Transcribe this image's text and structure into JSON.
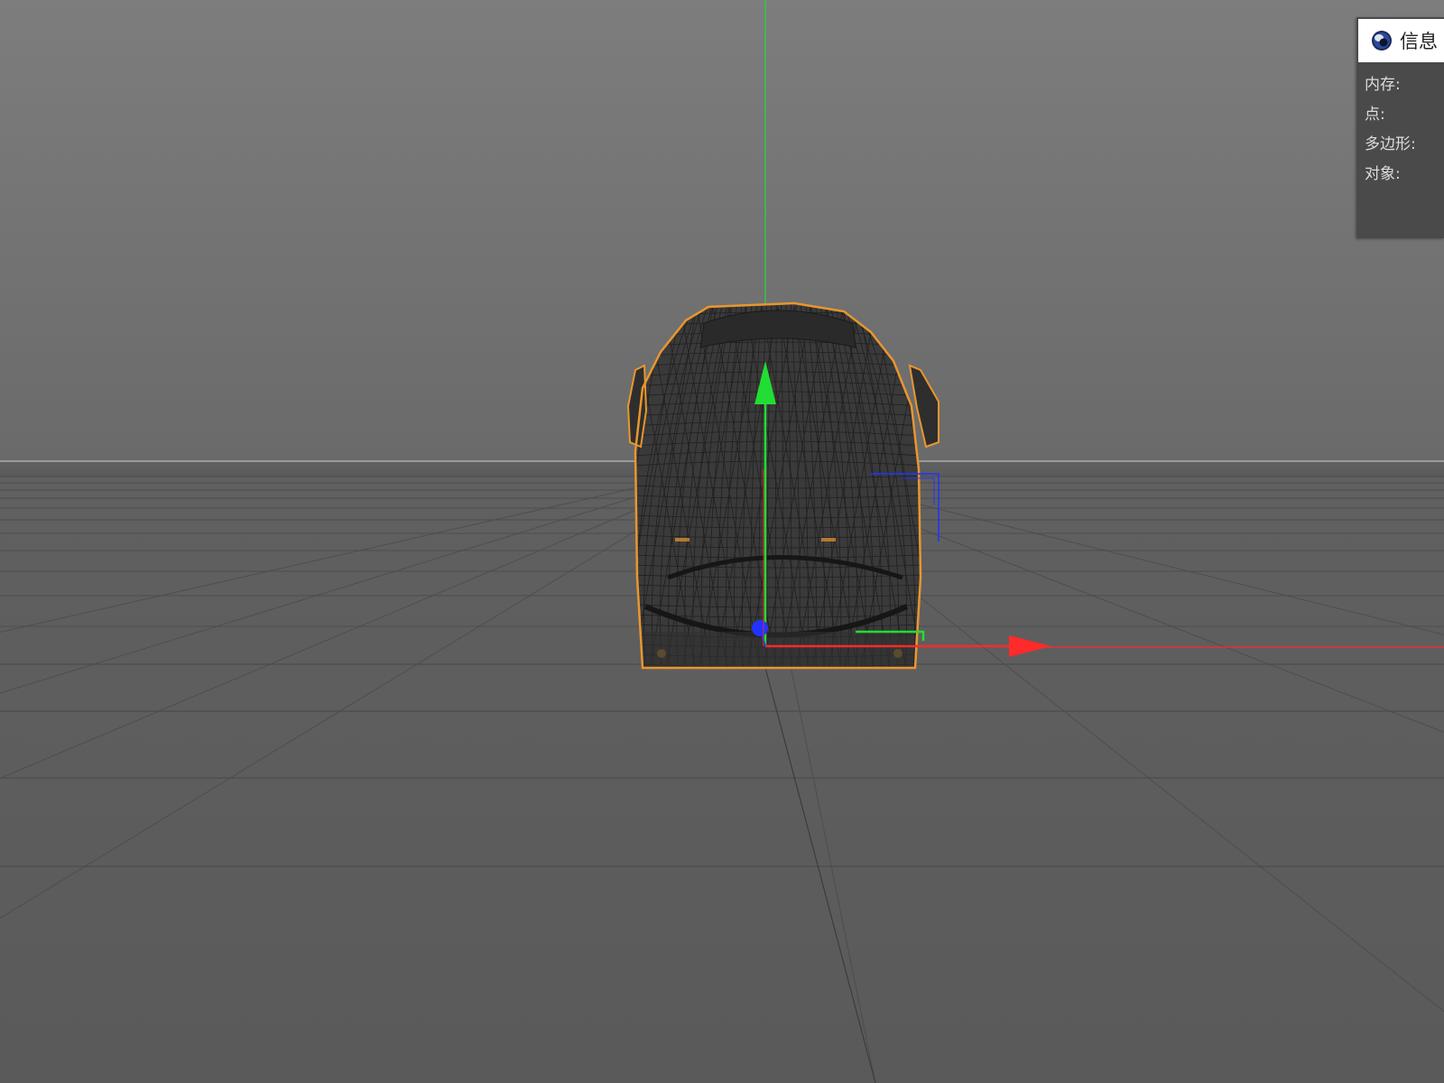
{
  "viewport": {
    "background_top": "#7b7b7b",
    "background_bottom": "#5f5f5f",
    "axis_colors": {
      "x": "#ff2a2a",
      "y": "#22dd33",
      "z": "#2233ff"
    },
    "selection_outline_color": "#e9962e",
    "wireframe_color": "#1e1e1e"
  },
  "info_panel": {
    "tab_icon": "cinema4d-logo-icon",
    "tab_title": "信息",
    "rows": [
      {
        "label": "内存:"
      },
      {
        "label": "点:"
      },
      {
        "label": "多边形:"
      },
      {
        "label": "对象:"
      }
    ]
  }
}
